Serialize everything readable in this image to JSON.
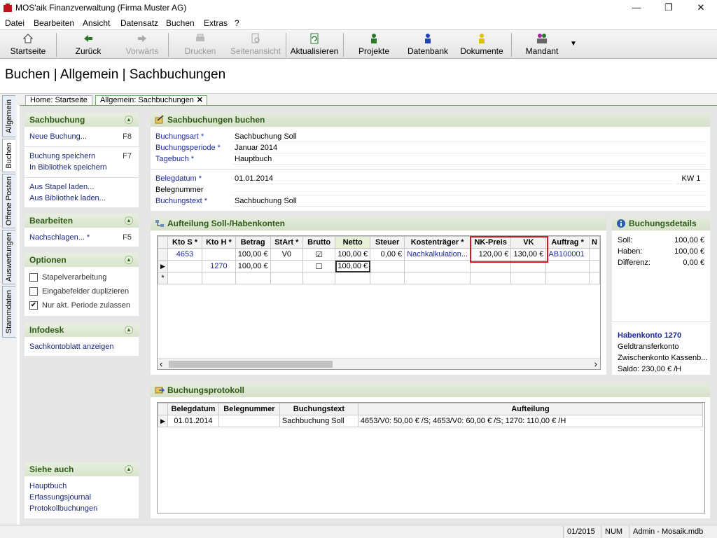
{
  "window": {
    "title": "MOS'aik Finanzverwaltung (Firma Muster AG)",
    "minimize": "—",
    "maximize": "❐",
    "close": "✕"
  },
  "menu": [
    "Datei",
    "Bearbeiten",
    "Ansicht",
    "Datensatz",
    "Buchen",
    "Extras",
    "?"
  ],
  "toolbar": {
    "startseite": "Startseite",
    "zurueck": "Zurück",
    "vorwaerts": "Vorwärts",
    "drucken": "Drucken",
    "seitenansicht": "Seitenansicht",
    "aktualisieren": "Aktualisieren",
    "projekte": "Projekte",
    "datenbank": "Datenbank",
    "dokumente": "Dokumente",
    "mandant": "Mandant"
  },
  "page_title": "Buchen | Allgemein | Sachbuchungen",
  "vtabs": [
    "Allgemein",
    "Buchen",
    "Offene Posten",
    "Auswertungen",
    "Stammdaten"
  ],
  "doctabs": {
    "home": "Home: Startseite",
    "current": "Allgemein: Sachbuchungen"
  },
  "sidebar": {
    "sachbuchung": {
      "title": "Sachbuchung",
      "neue": "Neue Buchung...",
      "neue_key": "F8",
      "speichern": "Buchung speichern",
      "speichern_key": "F7",
      "bibliothek": "In Bibliothek speichern",
      "stapel": "Aus Stapel laden...",
      "bibladen": "Aus Bibliothek laden..."
    },
    "bearbeiten": {
      "title": "Bearbeiten",
      "nachschlagen": "Nachschlagen... *",
      "nachschlagen_key": "F5"
    },
    "optionen": {
      "title": "Optionen",
      "stapel": "Stapelverarbeitung",
      "dupl": "Eingabefelder duplizieren",
      "periode": "Nur akt. Periode zulassen",
      "periode_checked": "✔"
    },
    "infodesk": {
      "title": "Infodesk",
      "sachkonto": "Sachkontoblatt anzeigen"
    },
    "siehe": {
      "title": "Siehe auch",
      "hauptbuch": "Hauptbuch",
      "journal": "Erfassungsjournal",
      "protokoll": "Protokollbuchungen"
    }
  },
  "form": {
    "title": "Sachbuchungen buchen",
    "buchungsart_l": "Buchungsart *",
    "buchungsart": "Sachbuchung Soll",
    "periode_l": "Buchungsperiode *",
    "periode": "Januar 2014",
    "tagebuch_l": "Tagebuch *",
    "tagebuch": "Hauptbuch",
    "belegdatum_l": "Belegdatum *",
    "belegdatum": "01.01.2014",
    "kw": "KW 1",
    "belegnummer_l": "Belegnummer",
    "belegnummer": "",
    "buchungstext_l": "Buchungstext *",
    "buchungstext": "Sachbuchung Soll"
  },
  "aufteilung": {
    "title": "Aufteilung Soll-/Habenkonten",
    "headers": [
      "Kto S *",
      "Kto H *",
      "Betrag",
      "StArt *",
      "Brutto",
      "Netto",
      "Steuer",
      "Kostenträger *",
      "NK-Preis",
      "VK",
      "Auftrag *",
      "N"
    ],
    "row1": {
      "kto_s": "4653",
      "kto_h": "",
      "betrag": "100,00 €",
      "start": "V0",
      "brutto": "☑",
      "netto": "100,00 €",
      "steuer": "0,00 €",
      "kostentraeger": "Nachkalkulation...",
      "nk": "120,00 €",
      "vk": "130,00 €",
      "auftrag": "AB100001"
    },
    "row2": {
      "kto_s": "",
      "kto_h": "1270",
      "betrag": "100,00 €",
      "start": "",
      "brutto": "☐",
      "netto": "100,00 €",
      "steuer": "",
      "kostentraeger": "",
      "nk": "",
      "vk": "",
      "auftrag": ""
    },
    "newrow": "*",
    "scroll_left": "‹",
    "scroll_right": "›"
  },
  "details": {
    "title": "Buchungsdetails",
    "soll_l": "Soll:",
    "soll": "100,00 €",
    "haben_l": "Haben:",
    "haben": "100,00 €",
    "diff_l": "Differenz:",
    "diff": "0,00 €",
    "konto_title": "Habenkonto 1270",
    "konto_1": "Geldtransferkonto",
    "konto_2": "Zwischenkonto Kassenb...",
    "saldo": "Saldo: 230,00 € /H"
  },
  "protokoll": {
    "title": "Buchungsprotokoll",
    "headers": [
      "Belegdatum",
      "Belegnummer",
      "Buchungstext",
      "Aufteilung"
    ],
    "row": {
      "datum": "01.01.2014",
      "nummer": "",
      "text": "Sachbuchung Soll",
      "aufteilung": "4653/V0: 50,00 € /S; 4653/V0: 60,00 € /S; 1270: 110,00 € /H"
    }
  },
  "status": {
    "periode": "01/2015",
    "num": "NUM",
    "user": "Admin - Mosaik.mdb"
  }
}
